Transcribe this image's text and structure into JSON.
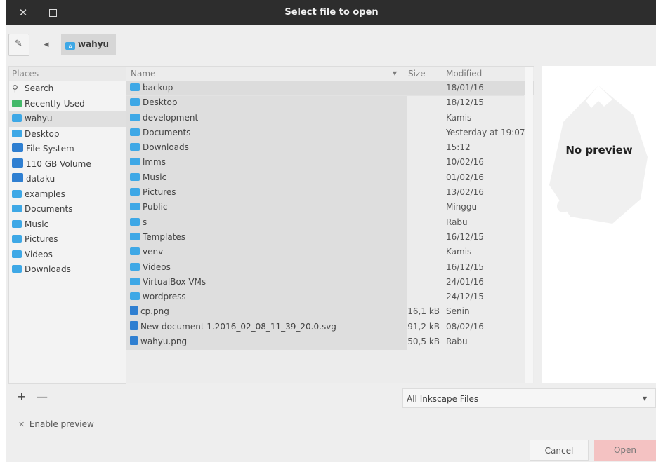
{
  "window": {
    "title": "Select file to open"
  },
  "pathbar": {
    "crumb": "wahyu"
  },
  "places": {
    "header": "Places",
    "items": [
      {
        "label": "Search",
        "icon": "search-icon"
      },
      {
        "label": "Recently Used",
        "icon": "recent-icon"
      },
      {
        "label": "wahyu",
        "icon": "home-folder-icon"
      },
      {
        "label": "Desktop",
        "icon": "desktop-icon"
      },
      {
        "label": "File System",
        "icon": "drive-icon"
      },
      {
        "label": "110 GB Volume",
        "icon": "drive-icon"
      },
      {
        "label": "dataku",
        "icon": "drive-icon"
      },
      {
        "label": "examples",
        "icon": "folder-icon"
      },
      {
        "label": "Documents",
        "icon": "documents-folder-icon"
      },
      {
        "label": "Music",
        "icon": "music-folder-icon"
      },
      {
        "label": "Pictures",
        "icon": "pictures-folder-icon"
      },
      {
        "label": "Videos",
        "icon": "videos-folder-icon"
      },
      {
        "label": "Downloads",
        "icon": "downloads-folder-icon"
      }
    ]
  },
  "files": {
    "columns": {
      "name": "Name",
      "size": "Size",
      "modified": "Modified"
    },
    "rows": [
      {
        "name": "backup",
        "size": "",
        "modified": "18/01/16",
        "type": "folder"
      },
      {
        "name": "Desktop",
        "size": "",
        "modified": "18/12/15",
        "type": "folder"
      },
      {
        "name": "development",
        "size": "",
        "modified": "Kamis",
        "type": "folder"
      },
      {
        "name": "Documents",
        "size": "",
        "modified": "Yesterday at 19:07",
        "type": "folder"
      },
      {
        "name": "Downloads",
        "size": "",
        "modified": "15:12",
        "type": "folder"
      },
      {
        "name": "lmms",
        "size": "",
        "modified": "10/02/16",
        "type": "folder"
      },
      {
        "name": "Music",
        "size": "",
        "modified": "01/02/16",
        "type": "folder"
      },
      {
        "name": "Pictures",
        "size": "",
        "modified": "13/02/16",
        "type": "folder"
      },
      {
        "name": "Public",
        "size": "",
        "modified": "Minggu",
        "type": "folder"
      },
      {
        "name": "s",
        "size": "",
        "modified": "Rabu",
        "type": "folder"
      },
      {
        "name": "Templates",
        "size": "",
        "modified": "16/12/15",
        "type": "folder"
      },
      {
        "name": "venv",
        "size": "",
        "modified": "Kamis",
        "type": "folder"
      },
      {
        "name": "Videos",
        "size": "",
        "modified": "16/12/15",
        "type": "folder"
      },
      {
        "name": "VirtualBox VMs",
        "size": "",
        "modified": "24/01/16",
        "type": "folder"
      },
      {
        "name": "wordpress",
        "size": "",
        "modified": "24/12/15",
        "type": "folder"
      },
      {
        "name": "cp.png",
        "size": "16,1 kB",
        "modified": "Senin",
        "type": "file"
      },
      {
        "name": "New document 1.2016_02_08_11_39_20.0.svg",
        "size": "91,2 kB",
        "modified": "08/02/16",
        "type": "file"
      },
      {
        "name": "wahyu.png",
        "size": "50,5 kB",
        "modified": "Rabu",
        "type": "file"
      }
    ]
  },
  "preview": {
    "text": "No preview"
  },
  "filter": {
    "selected": "All Inkscape Files"
  },
  "options": {
    "enable_preview": "Enable preview"
  },
  "buttons": {
    "cancel": "Cancel",
    "open": "Open"
  },
  "colors": {
    "titlebar": "#2d2d2d",
    "folder": "#3ea8e6",
    "open_button": "#f4c2c2"
  }
}
